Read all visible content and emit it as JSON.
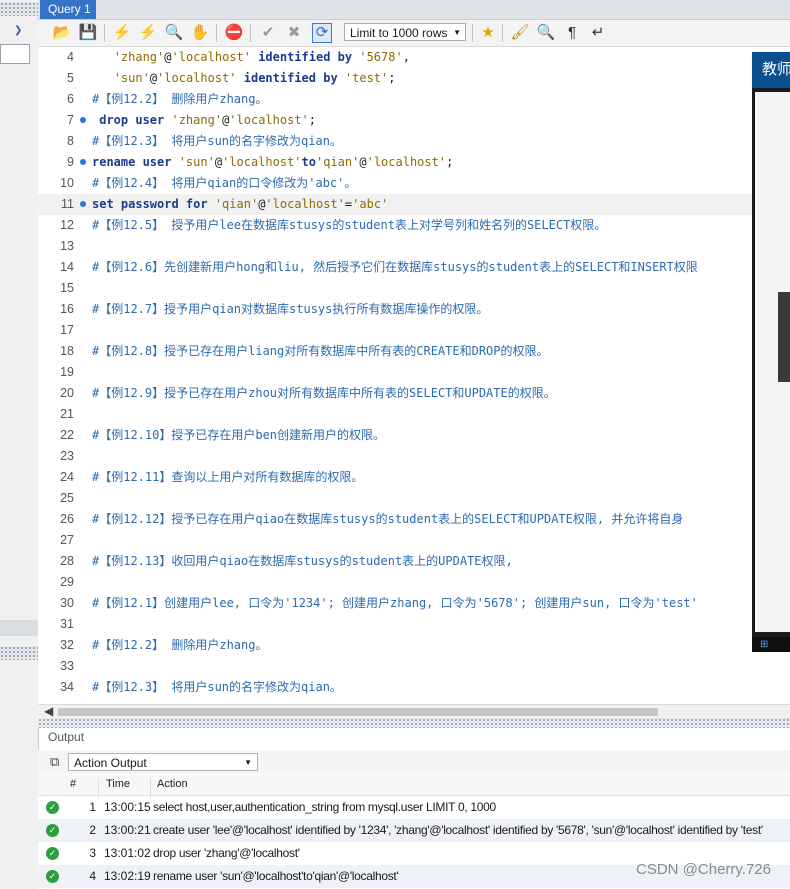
{
  "tabs": [
    {
      "label": "Query 1"
    }
  ],
  "toolbar": {
    "limit_select": "Limit to 1000 rows"
  },
  "editor": {
    "lines": [
      {
        "n": "4",
        "code": [
          {
            "t": "   ",
            "c": "pl"
          },
          {
            "t": "'zhang'",
            "c": "st"
          },
          {
            "t": "@",
            "c": "pl"
          },
          {
            "t": "'localhost'",
            "c": "st"
          },
          {
            "t": " identified by ",
            "c": "kw"
          },
          {
            "t": "'5678'",
            "c": "st"
          },
          {
            "t": ",",
            "c": "pl"
          }
        ]
      },
      {
        "n": "5",
        "code": [
          {
            "t": "   ",
            "c": "pl"
          },
          {
            "t": "'sun'",
            "c": "st"
          },
          {
            "t": "@",
            "c": "pl"
          },
          {
            "t": "'localhost'",
            "c": "st"
          },
          {
            "t": " identified by ",
            "c": "kw"
          },
          {
            "t": "'test'",
            "c": "st"
          },
          {
            "t": ";",
            "c": "pl"
          }
        ]
      },
      {
        "n": "6",
        "code": [
          {
            "t": "#【例12.2】 删除用户zhang。",
            "c": "cm"
          }
        ]
      },
      {
        "n": "7",
        "dot": true,
        "code": [
          {
            "t": " drop user ",
            "c": "kw"
          },
          {
            "t": "'zhang'",
            "c": "st"
          },
          {
            "t": "@",
            "c": "pl"
          },
          {
            "t": "'localhost'",
            "c": "st"
          },
          {
            "t": ";",
            "c": "pl"
          }
        ]
      },
      {
        "n": "8",
        "code": [
          {
            "t": "#【例12.3】 将用户sun的名字修改为qian。",
            "c": "cm"
          }
        ]
      },
      {
        "n": "9",
        "dot": true,
        "code": [
          {
            "t": "rename user ",
            "c": "kw"
          },
          {
            "t": "'sun'",
            "c": "st"
          },
          {
            "t": "@",
            "c": "pl"
          },
          {
            "t": "'localhost'",
            "c": "st"
          },
          {
            "t": "to",
            "c": "kw"
          },
          {
            "t": "'qian'",
            "c": "st"
          },
          {
            "t": "@",
            "c": "pl"
          },
          {
            "t": "'localhost'",
            "c": "st"
          },
          {
            "t": ";",
            "c": "pl"
          }
        ]
      },
      {
        "n": "10",
        "code": [
          {
            "t": "#【例12.4】 将用户qian的口令修改为'abc'。",
            "c": "cm"
          }
        ]
      },
      {
        "n": "11",
        "dot": true,
        "cur": true,
        "code": [
          {
            "t": "set password for ",
            "c": "kw"
          },
          {
            "t": "'qian'",
            "c": "st"
          },
          {
            "t": "@",
            "c": "pl"
          },
          {
            "t": "'localhost'",
            "c": "st"
          },
          {
            "t": "=",
            "c": "pl"
          },
          {
            "t": "'abc'",
            "c": "st"
          }
        ]
      },
      {
        "n": "12",
        "code": [
          {
            "t": "#【例12.5】 授予用户lee在数据库stusys的student表上对学号列和姓名列的SELECT权限。",
            "c": "cm"
          }
        ]
      },
      {
        "n": "13",
        "code": []
      },
      {
        "n": "14",
        "code": [
          {
            "t": "#【例12.6】先创建新用户hong和liu, 然后授予它们在数据库stusys的student表上的SELECT和INSERT权限",
            "c": "cm"
          }
        ]
      },
      {
        "n": "15",
        "code": []
      },
      {
        "n": "16",
        "code": [
          {
            "t": "#【例12.7】授予用户qian对数据库stusys执行所有数据库操作的权限。",
            "c": "cm"
          }
        ]
      },
      {
        "n": "17",
        "code": []
      },
      {
        "n": "18",
        "code": [
          {
            "t": "#【例12.8】授予已存在用户liang对所有数据库中所有表的CREATE和DROP的权限。",
            "c": "cm"
          }
        ]
      },
      {
        "n": "19",
        "code": []
      },
      {
        "n": "20",
        "code": [
          {
            "t": "#【例12.9】授予已存在用户zhou对所有数据库中所有表的SELECT和UPDATE的权限。",
            "c": "cm"
          }
        ]
      },
      {
        "n": "21",
        "code": []
      },
      {
        "n": "22",
        "code": [
          {
            "t": "#【例12.10】授予已存在用户ben创建新用户的权限。",
            "c": "cm"
          }
        ]
      },
      {
        "n": "23",
        "code": []
      },
      {
        "n": "24",
        "code": [
          {
            "t": "#【例12.11】查询以上用户对所有数据库的权限。",
            "c": "cm"
          }
        ]
      },
      {
        "n": "25",
        "code": []
      },
      {
        "n": "26",
        "code": [
          {
            "t": "#【例12.12】授予已存在用户qiao在数据库stusys的student表上的SELECT和UPDATE权限, 并允许将自身",
            "c": "cm"
          }
        ]
      },
      {
        "n": "27",
        "code": []
      },
      {
        "n": "28",
        "code": [
          {
            "t": "#【例12.13】收回用户qiao在数据库stusys的student表上的UPDATE权限,",
            "c": "cm"
          }
        ]
      },
      {
        "n": "29",
        "code": []
      },
      {
        "n": "30",
        "code": [
          {
            "t": "#【例12.1】创建用户lee, 口令为'1234'; 创建用户zhang, 口令为'5678'; 创建用户sun, 口令为'test'",
            "c": "cm"
          }
        ]
      },
      {
        "n": "31",
        "code": []
      },
      {
        "n": "32",
        "code": [
          {
            "t": "#【例12.2】 删除用户zhang。",
            "c": "cm"
          }
        ]
      },
      {
        "n": "33",
        "code": []
      },
      {
        "n": "34",
        "code": [
          {
            "t": "#【例12.3】 将用户sun的名字修改为qian。",
            "c": "cm"
          }
        ]
      }
    ]
  },
  "overlay": {
    "title": "教师"
  },
  "output": {
    "title": "Output",
    "selector": "Action Output",
    "columns": {
      "num": "#",
      "time": "Time",
      "action": "Action"
    },
    "rows": [
      {
        "num": "1",
        "time": "13:00:15",
        "action": "select host,user,authentication_string from mysql.user LIMIT 0, 1000"
      },
      {
        "num": "2",
        "time": "13:00:21",
        "action": "create user 'lee'@'localhost' identified by '1234', 'zhang'@'localhost' identified by '5678',     'sun'@'localhost' identified by 'test'"
      },
      {
        "num": "3",
        "time": "13:01:02",
        "action": "drop user 'zhang'@'localhost'"
      },
      {
        "num": "4",
        "time": "13:02:19",
        "action": "rename user 'sun'@'localhost'to'qian'@'localhost'"
      }
    ]
  },
  "watermark": "CSDN @Cherry.726",
  "colors": {
    "tab_active": "#3573c8",
    "keyword": "#1d3b8c",
    "string": "#8f6a00",
    "comment": "#2b6bb0",
    "success": "#2c9e3c"
  }
}
